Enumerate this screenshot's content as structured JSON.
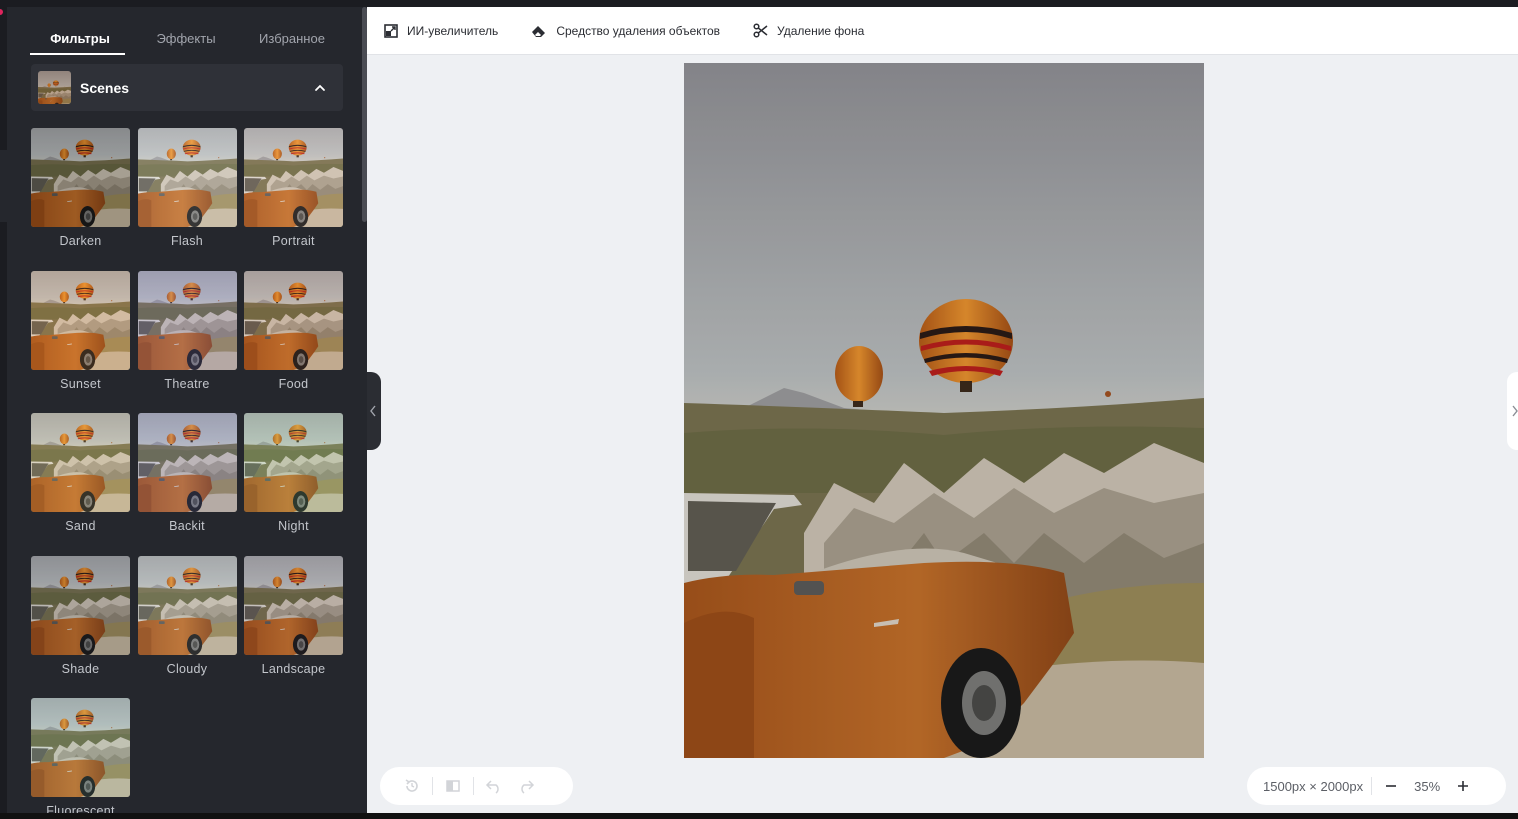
{
  "sidebar": {
    "tabs": [
      {
        "label": "Фильтры",
        "active": true
      },
      {
        "label": "Эффекты",
        "active": false
      },
      {
        "label": "Избранное",
        "active": false
      }
    ],
    "section": {
      "title": "Scenes",
      "expanded": true
    },
    "filters": [
      {
        "name": "Darken",
        "tint": "rgba(0,0,0,0.18)"
      },
      {
        "name": "Flash",
        "tint": "rgba(255,255,255,0.12)"
      },
      {
        "name": "Portrait",
        "tint": "rgba(255,210,190,0.10)"
      },
      {
        "name": "Sunset",
        "tint": "rgba(255,150,60,0.14)"
      },
      {
        "name": "Theatre",
        "tint": "rgba(120,110,200,0.18)"
      },
      {
        "name": "Food",
        "tint": "rgba(180,90,50,0.12)"
      },
      {
        "name": "Sand",
        "tint": "rgba(230,200,120,0.14)"
      },
      {
        "name": "Backit",
        "tint": "rgba(110,120,210,0.16)"
      },
      {
        "name": "Night",
        "tint": "rgba(150,220,150,0.16)"
      },
      {
        "name": "Shade",
        "tint": "rgba(20,20,30,0.16)"
      },
      {
        "name": "Cloudy",
        "tint": "rgba(160,170,170,0.14)"
      },
      {
        "name": "Landscape",
        "tint": "rgba(60,30,60,0.12)"
      },
      {
        "name": "Fluorescent",
        "tint": "rgba(120,200,180,0.12)"
      }
    ]
  },
  "toolbar": {
    "tools": [
      {
        "label": "ИИ-увеличитель",
        "icon": "ai-upscale-icon"
      },
      {
        "label": "Средство удаления объектов",
        "icon": "eraser-icon"
      },
      {
        "label": "Удаление фона",
        "icon": "scissors-icon"
      }
    ]
  },
  "canvas": {
    "dimensions": "1500px × 2000px",
    "zoom": "35%"
  },
  "colors": {
    "sidebar_bg": "#25272d",
    "canvas_bg": "#eef0f3",
    "accent_car": "#b8621f"
  }
}
